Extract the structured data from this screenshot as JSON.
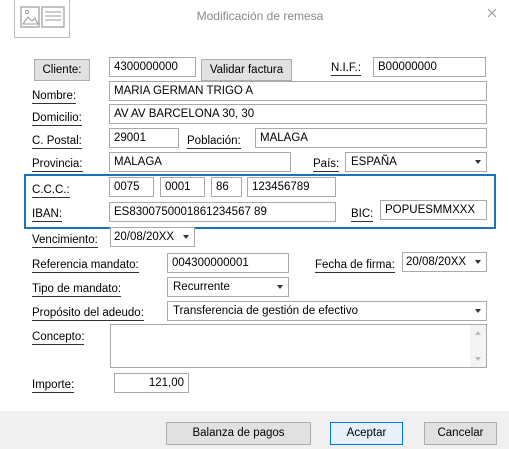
{
  "window": {
    "title": "Modificación de remesa"
  },
  "customer": {
    "cliente_btn": "Cliente:",
    "cliente_value": "4300000000",
    "validar_btn": "Validar factura",
    "nif_label": "N.I.F.:",
    "nif_value": "B00000000",
    "nombre_label": "Nombre:",
    "nombre_value": "MARIA GERMAN TRIGO A",
    "domicilio_label": "Domicilio:",
    "domicilio_value": "AV AV BARCELONA 30, 30",
    "cpostal_label": "C. Postal:",
    "cpostal_value": "29001",
    "poblacion_label": "Población:",
    "poblacion_value": "MALAGA",
    "provincia_label": "Provincia:",
    "provincia_value": "MALAGA",
    "pais_label": "País:",
    "pais_value": "ESPAÑA"
  },
  "bank": {
    "ccc_label": "C.C.C.:",
    "ccc_entidad": "0075",
    "ccc_oficina": "0001",
    "ccc_dc": "86",
    "ccc_cuenta": "123456789",
    "iban_label": "IBAN:",
    "iban_value": "ES8300750001861234567 89",
    "bic_label": "BIC:",
    "bic_value": "POPUESMMXXX",
    "highlight_color": "#1a73b8"
  },
  "mandate": {
    "vencimiento_label": "Vencimiento:",
    "vencimiento_value": "20/08/20XX",
    "referencia_label": "Referencia mandato:",
    "referencia_value": "004300000001",
    "fecha_firma_label": "Fecha de firma:",
    "fecha_firma_value": "20/08/20XX",
    "tipo_label": "Tipo de mandato:",
    "tipo_value": "Recurrente",
    "proposito_label": "Propósito del adeudo:",
    "proposito_value": "Transferencia de gestión de efectivo",
    "concepto_label": "Concepto:",
    "concepto_value": "",
    "importe_label": "Importe:",
    "importe_value": "121,00"
  },
  "footer": {
    "balanza_btn": "Balanza de pagos",
    "aceptar_btn": "Aceptar",
    "cancelar_btn": "Cancelar"
  }
}
